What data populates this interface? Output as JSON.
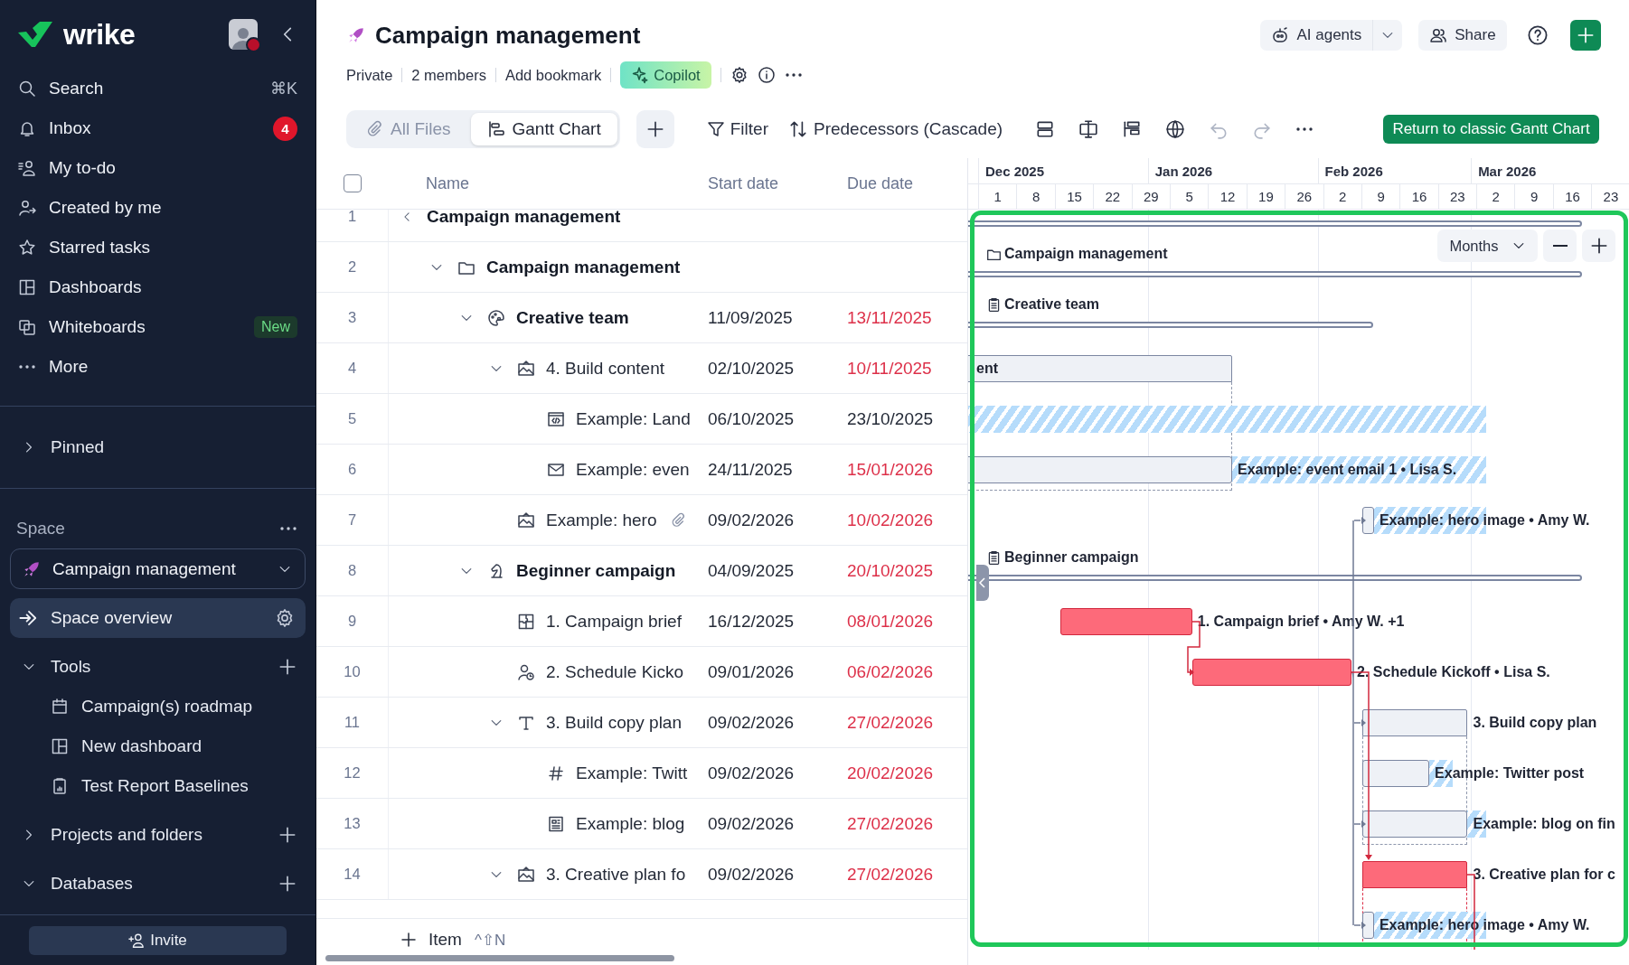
{
  "sidebar": {
    "logo": "wrike",
    "nav": [
      {
        "label": "Search",
        "kind": "search",
        "shortcut": "⌘K",
        "selected": false
      },
      {
        "label": "Inbox",
        "kind": "inbox",
        "badge": "4",
        "selected": false
      },
      {
        "label": "My to-do",
        "kind": "todo",
        "selected": false
      },
      {
        "label": "Created by me",
        "kind": "created",
        "selected": false
      },
      {
        "label": "Starred tasks",
        "kind": "starred",
        "selected": false
      },
      {
        "label": "Dashboards",
        "kind": "dashboards",
        "selected": false
      },
      {
        "label": "Whiteboards",
        "kind": "whiteboards",
        "tag": "New",
        "selected": false
      },
      {
        "label": "More",
        "kind": "more",
        "selected": false
      }
    ],
    "pinned": {
      "label": "Pinned",
      "expanded": false
    },
    "space": {
      "label": "Space",
      "current": "Campaign management",
      "overview": {
        "label": "Space overview",
        "selected": true
      }
    },
    "sections": [
      {
        "label": "Tools",
        "expanded": true,
        "items": [
          {
            "label": "Campaign(s) roadmap",
            "kind": "calendar",
            "selected": false
          },
          {
            "label": "New dashboard",
            "kind": "dashboard",
            "selected": false
          },
          {
            "label": "Test Report Baselines",
            "kind": "report",
            "selected": false
          }
        ]
      },
      {
        "label": "Projects and folders",
        "expanded": false
      },
      {
        "label": "Databases",
        "expanded": true
      }
    ],
    "invite": "Invite"
  },
  "header": {
    "title": "Campaign management",
    "meta": [
      "Private",
      "2 members",
      "Add bookmark"
    ],
    "copilot": "Copilot",
    "ai_agents": "AI agents",
    "share": "Share"
  },
  "toolbar": {
    "views": [
      {
        "label": "All Files",
        "kind": "files",
        "selected": false
      },
      {
        "label": "Gantt Chart",
        "kind": "gantt",
        "selected": true
      }
    ],
    "filter": "Filter",
    "predecessors": "Predecessors (Cascade)",
    "history": [
      {
        "kind": "undo",
        "disabled": true
      },
      {
        "kind": "redo",
        "disabled": true
      }
    ],
    "return": "Return to classic Gantt Chart"
  },
  "table": {
    "checked": false,
    "columns": [
      "Name",
      "Start date",
      "Due date"
    ],
    "rows": [
      {
        "number": "1",
        "name": "Campaign management",
        "kind": "root",
        "children": [
          {
            "number": "2",
            "name": "Campaign management",
            "kind": "folder",
            "expanded": true,
            "children": [
              {
                "number": "3",
                "name": "Creative team",
                "kind": "team",
                "expanded": true,
                "start": "11/09/2025",
                "due": "13/11/2025",
                "overdue": true,
                "children": [
                  {
                    "number": "4",
                    "name": "4. Build content",
                    "kind": "image",
                    "expanded": true,
                    "start": "02/10/2025",
                    "due": "10/11/2025",
                    "overdue": true,
                    "children": [
                      {
                        "number": "5",
                        "name": "Example: Land",
                        "kind": "code",
                        "start": "06/10/2025",
                        "due": "23/10/2025",
                        "overdue": false
                      },
                      {
                        "number": "6",
                        "name": "Example: even",
                        "kind": "email",
                        "start": "24/11/2025",
                        "due": "15/01/2026",
                        "overdue": true
                      }
                    ]
                  },
                  {
                    "number": "7",
                    "name": "Example: hero",
                    "kind": "image",
                    "attachment": true,
                    "start": "09/02/2026",
                    "due": "10/02/2026",
                    "overdue": true
                  }
                ]
              },
              {
                "number": "8",
                "name": "Beginner campaign",
                "kind": "goal",
                "expanded": true,
                "start": "04/09/2025",
                "due": "20/10/2025",
                "overdue": true,
                "children": [
                  {
                    "number": "9",
                    "name": "1. Campaign brief",
                    "kind": "puzzle",
                    "start": "16/12/2025",
                    "due": "08/01/2026",
                    "overdue": true
                  },
                  {
                    "number": "10",
                    "name": "2. Schedule Kicko",
                    "kind": "person",
                    "start": "09/01/2026",
                    "due": "06/02/2026",
                    "overdue": true
                  },
                  {
                    "number": "11",
                    "name": "3. Build copy plan",
                    "kind": "text",
                    "expanded": true,
                    "start": "09/02/2026",
                    "due": "27/02/2026",
                    "overdue": true,
                    "children": [
                      {
                        "number": "12",
                        "name": "Example: Twitt",
                        "kind": "hash",
                        "start": "09/02/2026",
                        "due": "20/02/2026",
                        "overdue": true
                      },
                      {
                        "number": "13",
                        "name": "Example: blog",
                        "kind": "doc",
                        "start": "09/02/2026",
                        "due": "27/02/2026",
                        "overdue": true
                      }
                    ]
                  },
                  {
                    "number": "14",
                    "name": "3. Creative plan fo",
                    "kind": "image",
                    "expanded": true,
                    "start": "09/02/2026",
                    "due": "27/02/2026",
                    "overdue": true
                  }
                ]
              }
            ]
          }
        ]
      }
    ],
    "add_item": "Item",
    "add_shortcut": "^⇧N"
  },
  "gantt": {
    "months": [
      "Dec 2025",
      "Jan 2026",
      "Feb 2026",
      "Mar 2026"
    ],
    "weeks": [
      "1",
      "8",
      "15",
      "22",
      "29",
      "5",
      "12",
      "19",
      "26",
      "2",
      "9",
      "16",
      "23",
      "2",
      "9",
      "16",
      "23"
    ],
    "zoom": "Months",
    "bars": [
      {
        "kind": "summary"
      },
      {
        "kind": "folder",
        "label": "Campaign management"
      },
      {
        "kind": "project",
        "label": "Creative team"
      },
      {
        "kind": "group",
        "critical": false,
        "label": "ent"
      },
      {
        "kind": "task",
        "critical": false
      },
      {
        "kind": "task",
        "critical": false,
        "label": "Example: event email 1 • Lisa S."
      },
      {
        "kind": "task",
        "critical": false,
        "label": "Example: hero image • Amy W."
      },
      {
        "kind": "project",
        "label": "Beginner campaign"
      },
      {
        "kind": "task",
        "critical": true,
        "label": "1. Campaign brief • Amy W. +1"
      },
      {
        "kind": "task",
        "critical": true,
        "label": "2. Schedule Kickoff • Lisa S."
      },
      {
        "kind": "group",
        "critical": false,
        "label": "3. Build copy plan"
      },
      {
        "kind": "task",
        "critical": false,
        "label": "Example: Twitter post"
      },
      {
        "kind": "task",
        "critical": false,
        "label": "Example: blog on fin"
      },
      {
        "kind": "group",
        "critical": true,
        "label": "3. Creative plan for c"
      },
      {
        "kind": "task",
        "critical": false,
        "label": "Example: hero image • Amy W."
      }
    ]
  }
}
